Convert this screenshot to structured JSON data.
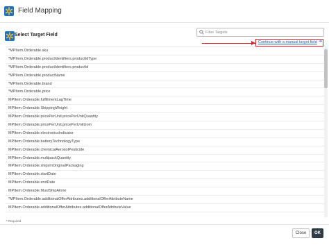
{
  "dialog": {
    "title": "Field Mapping",
    "logo_icon": "walmart-spark-icon"
  },
  "section": {
    "title": "Select Target Field",
    "logo_icon": "walmart-spark-icon"
  },
  "filter": {
    "placeholder": "Filter Targets",
    "value": "",
    "icon": "search-icon"
  },
  "manual_link": {
    "label": "Continue with a manual target field",
    "arrow": "➔"
  },
  "target_fields": [
    "*MPItem.Orderable.sku",
    "*MPItem.Orderable.productIdentifiers.productIdType",
    "*MPItem.Orderable.productIdentifiers.productId",
    "*MPItem.Orderable.productName",
    "*MPItem.Orderable.brand",
    "*MPItem.Orderable.price",
    "MPItem.Orderable.fulfillmentLagTime",
    "MPItem.Orderable.ShippingWeight",
    "MPItem.Orderable.pricePerUnit.pricePerUnitQuantity",
    "MPItem.Orderable.pricePerUnit.pricePerUnitUom",
    "MPItem.Orderable.electronicsIndicator",
    "MPItem.Orderable.batteryTechnologyType",
    "MPItem.Orderable.chemicalAerosolPesticide",
    "MPItem.Orderable.multipackQuantity",
    "MPItem.Orderable.shipsInOriginalPackaging",
    "MPItem.Orderable.startDate",
    "MPItem.Orderable.endDate",
    "MPItem.Orderable.MustShipAlone",
    "*MPItem.Orderable.additionalOfferAttributes.additionalOfferAttributeName",
    "MPItem.Orderable.additionalOfferAttributes.additionalOfferAttributeValue"
  ],
  "required_note": "* Required",
  "buttons": {
    "close": "Close",
    "ok": "OK"
  },
  "colors": {
    "accent": "#1a72c8",
    "annotation": "#d9252a",
    "ok_button": "#2f3d4b"
  }
}
